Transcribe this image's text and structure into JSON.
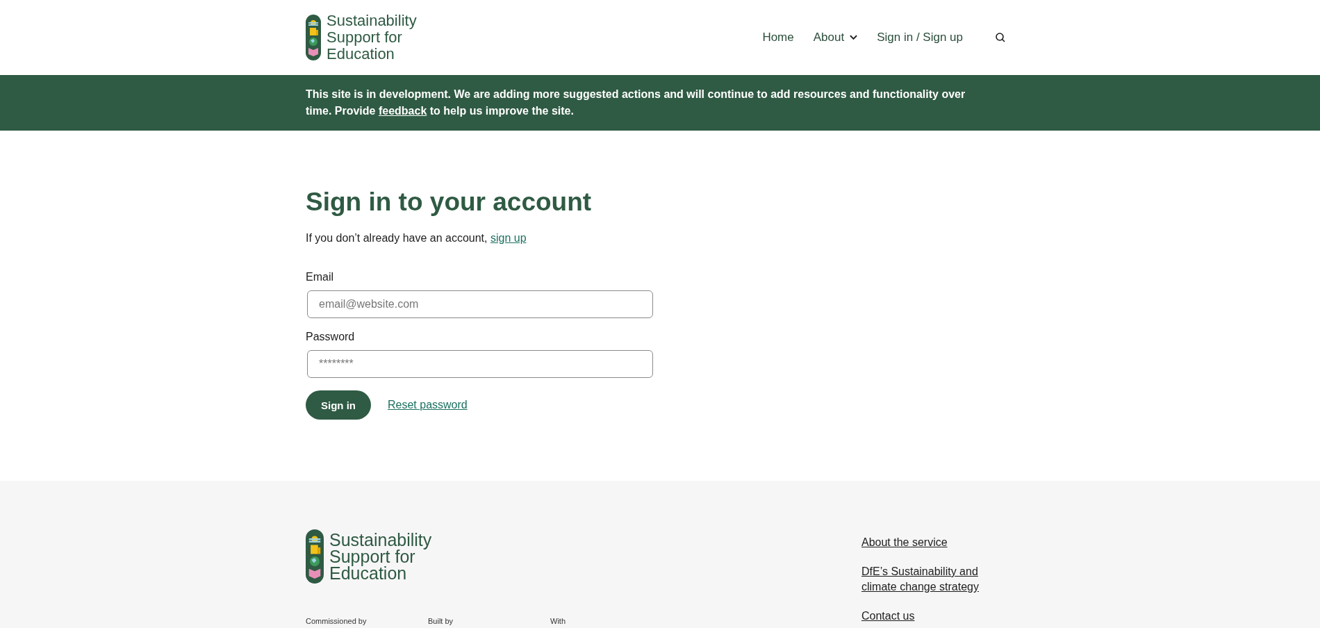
{
  "header": {
    "logo_lines": [
      "Sustainability",
      "Support for",
      "Education"
    ],
    "nav": [
      {
        "label": "Home",
        "kind": "link"
      },
      {
        "label": "About",
        "kind": "dropdown"
      },
      {
        "label": "Sign in / Sign up",
        "kind": "link"
      }
    ]
  },
  "banner": {
    "text_before": "This site is in development. We are adding more suggested actions and will continue to add resources and functionality over time. Provide",
    "link": "feedback",
    "text_after": "to help us improve the site."
  },
  "main": {
    "title": "Sign in to your account",
    "intro": "If you don’t already have an account,",
    "intro_link": "sign up",
    "fields": [
      {
        "label": "Email",
        "placeholder": "email@website.com"
      },
      {
        "label": "Password",
        "placeholder": "********"
      }
    ],
    "submit": "Sign in",
    "reset_link": "Reset password"
  },
  "footer": {
    "logo_lines": [
      "Sustainability",
      "Support for",
      "Education"
    ],
    "credits": [
      "Commissioned by",
      "Built by",
      "With"
    ],
    "links": [
      "About the service",
      "DfE’s Sustainability and climate change strategy",
      "Contact us"
    ]
  }
}
